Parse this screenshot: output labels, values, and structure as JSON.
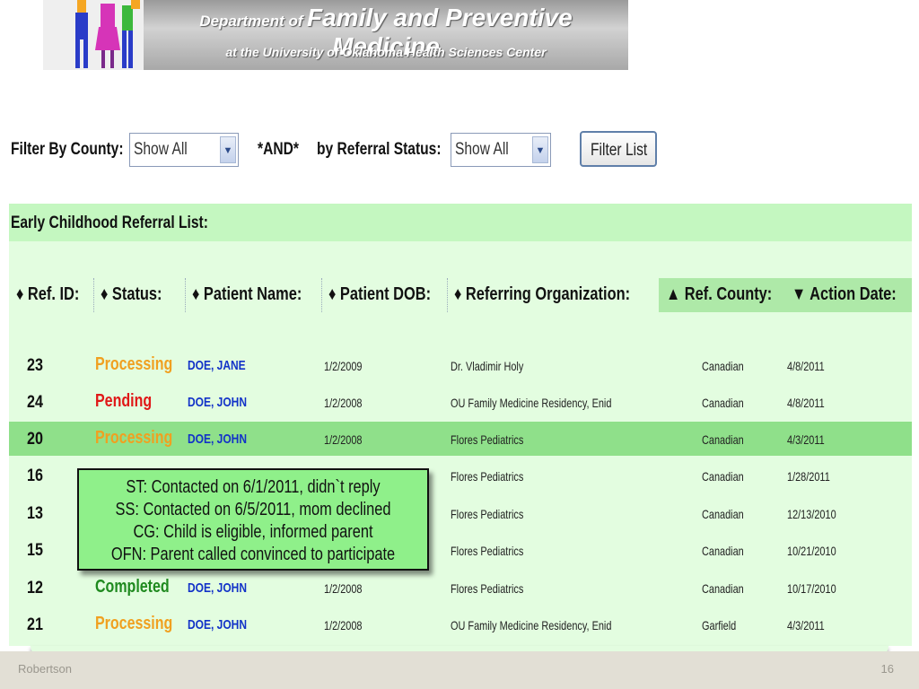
{
  "banner": {
    "line1_small": "Department of",
    "line1_big": "Family and Preventive Medicine",
    "line2": "at the University of Oklahoma Health Sciences Center"
  },
  "filter": {
    "county_label": "Filter By County:",
    "county_value": "Show All",
    "and_label": "*AND*",
    "status_label": "by Referral Status:",
    "status_value": "Show All",
    "button_label": "Filter List"
  },
  "list": {
    "title": "Early Childhood Referral List:",
    "headers": [
      "♦ Ref. ID:",
      "♦ Status:",
      "♦ Patient Name:",
      "♦ Patient DOB:",
      "♦ Referring Organization:",
      "▲ Ref. County:",
      "▼ Action Date:"
    ],
    "rows": [
      {
        "id": "23",
        "status": "Processing",
        "name": "DOE, JANE",
        "dob": "1/2/2009",
        "org": "Dr. Vladimir Holy",
        "county": "Canadian",
        "date": "4/8/2011"
      },
      {
        "id": "24",
        "status": "Pending",
        "name": "DOE, JOHN",
        "dob": "1/2/2008",
        "org": "OU Family Medicine Residency, Enid",
        "county": "Canadian",
        "date": "4/8/2011"
      },
      {
        "id": "20",
        "status": "Processing",
        "name": "DOE, JOHN",
        "dob": "1/2/2008",
        "org": "Flores Pediatrics",
        "county": "Canadian",
        "date": "4/3/2011"
      },
      {
        "id": "16",
        "status": "",
        "name": "",
        "dob": "",
        "org": "Flores Pediatrics",
        "county": "Canadian",
        "date": "1/28/2011"
      },
      {
        "id": "13",
        "status": "",
        "name": "",
        "dob": "",
        "org": "Flores Pediatrics",
        "county": "Canadian",
        "date": "12/13/2010"
      },
      {
        "id": "15",
        "status": "",
        "name": "",
        "dob": "",
        "org": "Flores Pediatrics",
        "county": "Canadian",
        "date": "10/21/2010"
      },
      {
        "id": "12",
        "status": "Completed",
        "name": "DOE, JOHN",
        "dob": "1/2/2008",
        "org": "Flores Pediatrics",
        "county": "Canadian",
        "date": "10/17/2010"
      },
      {
        "id": "21",
        "status": "Processing",
        "name": "DOE, JOHN",
        "dob": "1/2/2008",
        "org": "OU Family Medicine Residency, Enid",
        "county": "Garfield",
        "date": "4/3/2011"
      }
    ]
  },
  "tooltip": {
    "lines": [
      "ST: Contacted on 6/1/2011, didn`t reply",
      "SS: Contacted on 6/5/2011, mom declined",
      "CG: Child is eligible, informed parent",
      "OFN: Parent called convinced to participate"
    ]
  },
  "footer": {
    "author": "Robertson",
    "page": "16"
  },
  "colors": {
    "processing": "#f0a020",
    "pending": "#e01818",
    "completed": "#1f8a1f",
    "highlight_row": "#8fe08a",
    "list_background": "#e3fde0"
  }
}
